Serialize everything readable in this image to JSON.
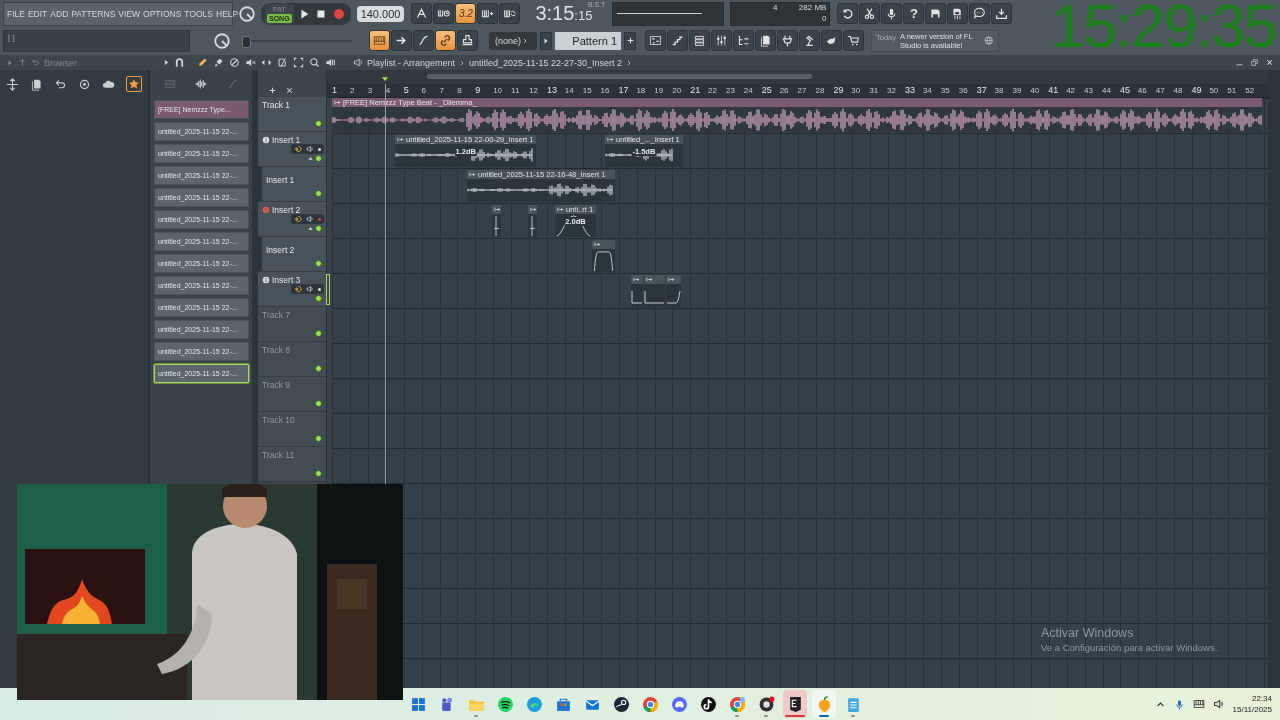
{
  "menu": [
    "FILE",
    "EDIT",
    "ADD",
    "PATTERNS",
    "VIEW",
    "OPTIONS",
    "TOOLS",
    "HELP"
  ],
  "transport": {
    "modes": [
      {
        "label": "PAT",
        "selected": false
      },
      {
        "label": "SONG",
        "selected": true
      }
    ],
    "tempo": "140.000"
  },
  "toggles_row1": [
    {
      "on": false
    },
    {
      "on": false
    },
    {
      "on": true,
      "label": "3.2"
    },
    {
      "on": false
    },
    {
      "on": false
    }
  ],
  "song_time": {
    "main": "3:15",
    "sub": ":15",
    "unit": "B:S:T"
  },
  "cpu_memory": {
    "voices": "4",
    "memory": "282 MB",
    "cpu": "0"
  },
  "help_label": "?",
  "hint_bar": {
    "text": "[ ]"
  },
  "pitch": {
    "level": 0.04
  },
  "toggles_row2": [
    {
      "on": true
    },
    {
      "on": false
    },
    {
      "on": false
    },
    {
      "on": true
    },
    {
      "on": false
    }
  ],
  "pattern": {
    "group": "(none)",
    "name": "Pattern 1"
  },
  "news": {
    "date": "Today",
    "message": "A newer version of FL Studio is available!"
  },
  "clock": "15:29:35",
  "browser": {
    "title": "Browser",
    "favorites_on": true
  },
  "playlist": {
    "breadcrumb": [
      "Playlist - Arrangement",
      "untitled_2025-11-15 22-27-30_Insert 2"
    ],
    "tools": [
      {
        "selected": true
      },
      {
        "selected": false
      },
      {
        "selected": false
      },
      {
        "selected": false
      },
      {
        "selected": false
      },
      {
        "selected": false
      },
      {
        "selected": false
      },
      {
        "selected": false
      },
      {
        "selected": false
      }
    ],
    "source_tabs": [
      {
        "selected": false
      },
      {
        "selected": true
      },
      {
        "selected": false
      }
    ],
    "clip_sources": [
      {
        "label": "[FREE] Nemzzz Type...",
        "color": "#7b5a70",
        "selected": false
      },
      {
        "label": "untitled_2025-11-15 22-...",
        "color": "#5c656b",
        "selected": false
      },
      {
        "label": "untitled_2025-11-15 22-...",
        "color": "#5c656b",
        "selected": false
      },
      {
        "label": "untitled_2025-11-15 22-...",
        "color": "#5c656b",
        "selected": false
      },
      {
        "label": "untitled_2025-11-15 22-...",
        "color": "#5c656b",
        "selected": false
      },
      {
        "label": "untitled_2025-11-15 22-...",
        "color": "#5c656b",
        "selected": false
      },
      {
        "label": "untitled_2025-11-15 22-...",
        "color": "#5c656b",
        "selected": false
      },
      {
        "label": "untitled_2025-11-15 22-...",
        "color": "#5c656b",
        "selected": false
      },
      {
        "label": "untitled_2025-11-15 22-...",
        "color": "#5c656b",
        "selected": false
      },
      {
        "label": "untitled_2025-11-15 22-...",
        "color": "#5c656b",
        "selected": false
      },
      {
        "label": "untitled_2025-11-15 22-...",
        "color": "#5c656b",
        "selected": false
      },
      {
        "label": "untitled_2025-11-15 22-...",
        "color": "#5c656b",
        "selected": false
      },
      {
        "label": "untitled_2025-11-15 22-...",
        "color": "#5c656b",
        "selected": true
      }
    ],
    "ruler": [
      "1",
      "2",
      "3",
      "4",
      "5",
      "6",
      "7",
      "8",
      "9",
      "10",
      "11",
      "12",
      "13",
      "14",
      "15",
      "16",
      "17",
      "18",
      "19",
      "20",
      "21",
      "22",
      "23",
      "24",
      "25",
      "26",
      "27",
      "28",
      "29",
      "30",
      "31",
      "32",
      "33",
      "34",
      "35",
      "36",
      "37",
      "38",
      "39",
      "40",
      "41",
      "42",
      "43",
      "44",
      "45",
      "46",
      "47",
      "48",
      "49",
      "50",
      "51",
      "52"
    ],
    "tracks": [
      {
        "name": "Track 1",
        "kind": "plain",
        "enabled": true,
        "selected": false,
        "clips": [
          {
            "kind": "sample",
            "title": "[FREE] Nemzzz Type Beat - _Dilemma_"
          }
        ]
      },
      {
        "name": "Insert 1",
        "kind": "audio",
        "armed": false,
        "expanded": true,
        "enabled": true,
        "selected": false,
        "clips": [
          {
            "kind": "audio",
            "title": "untitled_2025-11-15 22-00-29_Insert 1",
            "gain": "1.2dB"
          },
          {
            "kind": "audio",
            "title": "untitled_..._Insert 1",
            "gain": "-1.5dB"
          }
        ],
        "children": [
          {
            "name": "Insert 1",
            "kind": "lane",
            "enabled": true,
            "selected": false,
            "clips": [
              {
                "kind": "audio",
                "title": "untitled_2025-11-15 22-16-48_Insert 1"
              }
            ]
          }
        ]
      },
      {
        "name": "Insert 2",
        "kind": "audio",
        "armed": true,
        "expanded": true,
        "enabled": true,
        "selected": false,
        "clips": [
          {
            "kind": "automation"
          },
          {
            "kind": "automation"
          },
          {
            "kind": "automation",
            "title": "unti..rt 1",
            "gain": "2.0dB"
          }
        ],
        "children": [
          {
            "name": "Insert 2",
            "kind": "lane",
            "enabled": true,
            "selected": false,
            "clips": [
              {
                "kind": "automation"
              }
            ]
          }
        ]
      },
      {
        "name": "Insert 3",
        "kind": "audio",
        "armed": false,
        "expanded": false,
        "enabled": true,
        "selected": true,
        "clips": [
          {
            "kind": "automation"
          },
          {
            "kind": "automation"
          },
          {
            "kind": "automation"
          }
        ]
      },
      {
        "name": "Track 7",
        "kind": "empty",
        "enabled": true,
        "selected": false
      },
      {
        "name": "Track 8",
        "kind": "empty",
        "enabled": true,
        "selected": false
      },
      {
        "name": "Track 9",
        "kind": "empty",
        "enabled": true,
        "selected": false
      },
      {
        "name": "Track 10",
        "kind": "empty",
        "enabled": true,
        "selected": false
      },
      {
        "name": "Track 11",
        "kind": "empty",
        "enabled": true,
        "selected": false
      }
    ]
  },
  "webcam": {
    "kind": "picture"
  },
  "activation": {
    "title": "Activar Windows",
    "message": "Ve a Configuración para activar Windows."
  },
  "taskbar": {
    "apps": [
      {
        "open": false,
        "selected": false,
        "flashing": false
      },
      {
        "open": false,
        "selected": false,
        "flashing": false
      },
      {
        "open": true,
        "selected": false,
        "flashing": false
      },
      {
        "open": false,
        "selected": false,
        "flashing": false
      },
      {
        "open": false,
        "selected": false,
        "flashing": false
      },
      {
        "open": false,
        "selected": false,
        "flashing": false
      },
      {
        "open": false,
        "selected": false,
        "flashing": false
      },
      {
        "open": false,
        "selected": false,
        "flashing": false
      },
      {
        "open": false,
        "selected": false,
        "flashing": false
      },
      {
        "open": false,
        "selected": false,
        "flashing": false
      },
      {
        "open": false,
        "selected": false,
        "flashing": false
      },
      {
        "open": true,
        "selected": false,
        "flashing": false
      },
      {
        "open": true,
        "selected": false,
        "flashing": false
      },
      {
        "open": true,
        "selected": false,
        "flashing": true
      },
      {
        "open": true,
        "selected": true,
        "flashing": false
      },
      {
        "open": true,
        "selected": false,
        "flashing": false
      }
    ],
    "time": "22:34",
    "date": "15/11/2025"
  }
}
